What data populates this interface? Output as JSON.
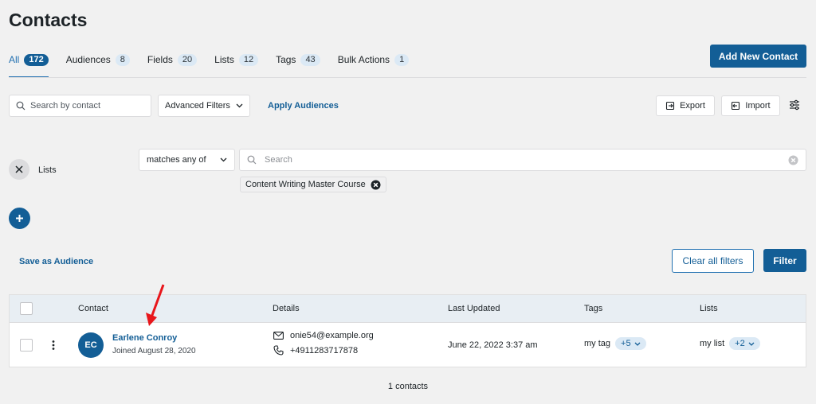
{
  "header": {
    "title": "Contacts",
    "add_button": "Add New Contact"
  },
  "tabs": [
    {
      "label": "All",
      "count": "172",
      "active": true
    },
    {
      "label": "Audiences",
      "count": "8"
    },
    {
      "label": "Fields",
      "count": "20"
    },
    {
      "label": "Lists",
      "count": "12"
    },
    {
      "label": "Tags",
      "count": "43"
    },
    {
      "label": "Bulk Actions",
      "count": "1"
    }
  ],
  "toolbar": {
    "search_placeholder": "Search by contact",
    "advanced_filters": "Advanced Filters",
    "apply_audiences": "Apply Audiences",
    "export": "Export",
    "import": "Import"
  },
  "filter": {
    "field": "Lists",
    "operator": "matches any of",
    "search_placeholder": "Search",
    "chip": "Content Writing Master Course"
  },
  "actions": {
    "save_audience": "Save as Audience",
    "clear_filters": "Clear all filters",
    "filter": "Filter"
  },
  "table": {
    "headers": {
      "contact": "Contact",
      "details": "Details",
      "updated": "Last Updated",
      "tags": "Tags",
      "lists": "Lists"
    },
    "rows": [
      {
        "initials": "EC",
        "name": "Earlene Conroy",
        "joined": "Joined August 28, 2020",
        "email": "onie54@example.org",
        "phone": "+4911283717878",
        "updated": "June 22, 2022 3:37 am",
        "tag": "my tag",
        "tag_more": "+5",
        "list": "my list",
        "list_more": "+2"
      }
    ]
  },
  "footer": {
    "count": "1 contacts"
  },
  "colors": {
    "primary": "#135e96",
    "badge_bg": "#dbe9f5",
    "annotation": "#e8161b"
  }
}
